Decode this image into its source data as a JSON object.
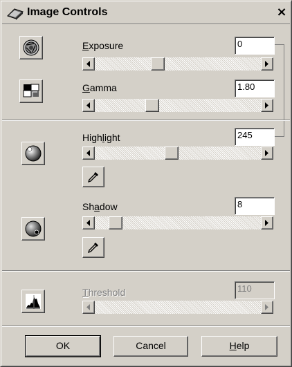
{
  "window": {
    "title": "Image Controls",
    "close_label": "×",
    "colors": {
      "face": "#d4d0c8",
      "shadow": "#808080",
      "highlight": "#ffffff",
      "dark": "#404040",
      "disabled_text": "#808080"
    }
  },
  "exposure": {
    "label": "Exposure",
    "mnemonic": "E",
    "rest": "xposure",
    "value": "0",
    "slider_position": 0.37,
    "icon": "aperture-icon"
  },
  "gamma": {
    "label": "Gamma",
    "mnemonic": "G",
    "rest": "amma",
    "value": "1.80",
    "slider_position": 0.33,
    "icon": "gamma-curve-icon"
  },
  "highlight": {
    "label": "Highlight",
    "before": "High",
    "mnemonic": "l",
    "after": "ight",
    "value": "245",
    "slider_position": 0.46,
    "icon": "highlight-sphere-icon",
    "picker_icon": "eyedropper-icon"
  },
  "shadow": {
    "label": "Shadow",
    "before": "Sh",
    "mnemonic": "a",
    "after": "dow",
    "value": "8",
    "slider_position": 0.09,
    "icon": "shadow-sphere-icon",
    "picker_icon": "eyedropper-icon"
  },
  "threshold": {
    "label": "Threshold",
    "mnemonic": "T",
    "rest": "hreshold",
    "value": "110",
    "disabled": true,
    "icon": "histogram-icon"
  },
  "buttons": {
    "ok": "OK",
    "cancel": "Cancel",
    "help_mnemonic": "H",
    "help_rest": "elp"
  }
}
